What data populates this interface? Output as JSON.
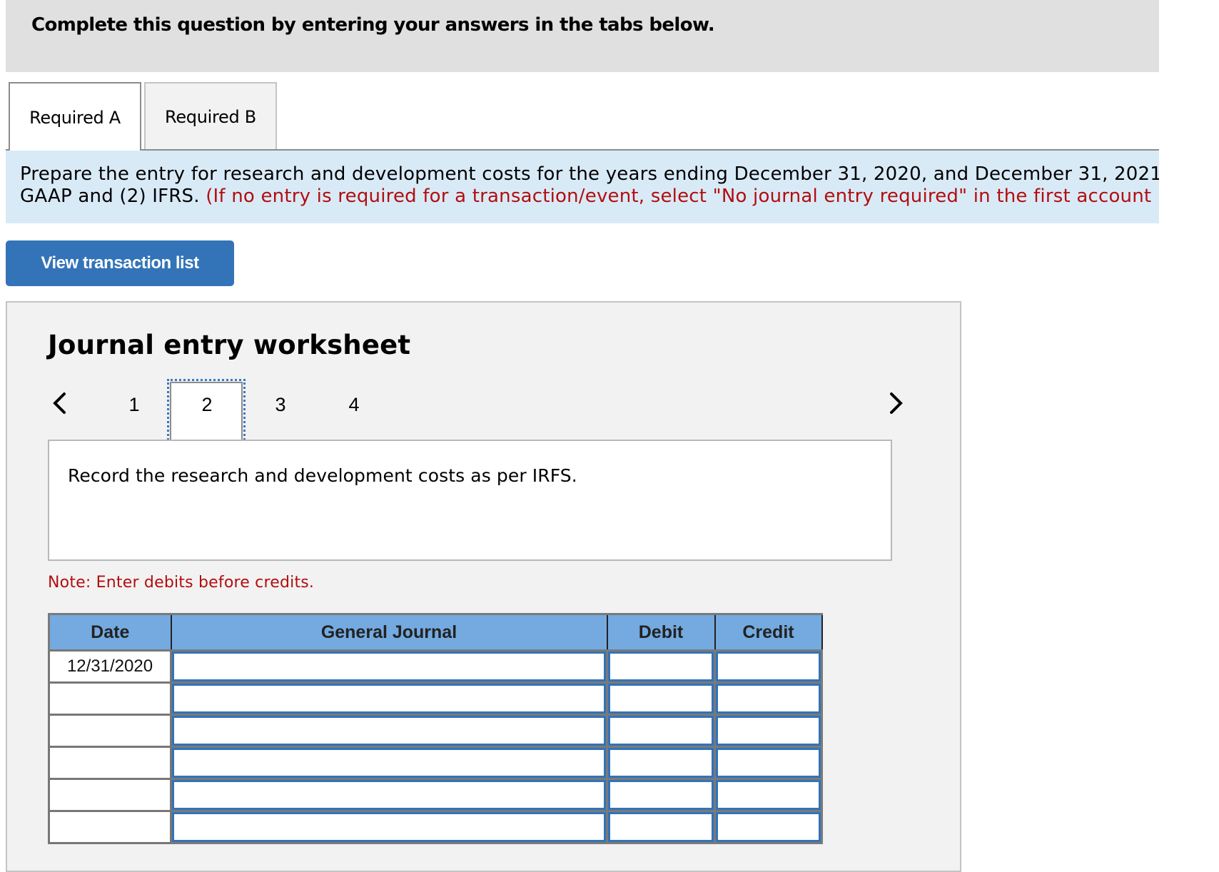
{
  "banner": {
    "title": "Complete this question by entering your answers in the tabs below."
  },
  "tabs": [
    {
      "label": "Required A",
      "active": true
    },
    {
      "label": "Required B",
      "active": false
    }
  ],
  "instructions": {
    "line1": "Prepare the entry for research and development costs for the years ending December 31, 2020, and December 31, 2021,",
    "line2_black": "GAAP and (2) IFRS. ",
    "line2_red": "(If no entry is required for a transaction/event, select \"No journal entry required\" in the first account"
  },
  "view_transaction_button": "View transaction list",
  "worksheet": {
    "heading": "Journal entry worksheet",
    "pagination": {
      "prev_icon": "chevron-left-icon",
      "next_icon": "chevron-right-icon",
      "pages": [
        "1",
        "2",
        "3",
        "4"
      ],
      "current_page": "2"
    },
    "description": "Record the research and development costs as per IRFS.",
    "note": "Note: Enter debits before credits.",
    "table": {
      "columns": [
        "Date",
        "General Journal",
        "Debit",
        "Credit"
      ],
      "rows": [
        {
          "date": "12/31/2020",
          "account": "",
          "debit": "",
          "credit": ""
        },
        {
          "date": "",
          "account": "",
          "debit": "",
          "credit": ""
        },
        {
          "date": "",
          "account": "",
          "debit": "",
          "credit": ""
        },
        {
          "date": "",
          "account": "",
          "debit": "",
          "credit": ""
        },
        {
          "date": "",
          "account": "",
          "debit": "",
          "credit": ""
        },
        {
          "date": "",
          "account": "",
          "debit": "",
          "credit": ""
        }
      ]
    }
  },
  "colors": {
    "header_band": "#e0e0e0",
    "instruction_band": "#d9eaf7",
    "accent_blue": "#3373b8",
    "table_header": "#74aae0",
    "warning_red": "#b20e0e"
  }
}
